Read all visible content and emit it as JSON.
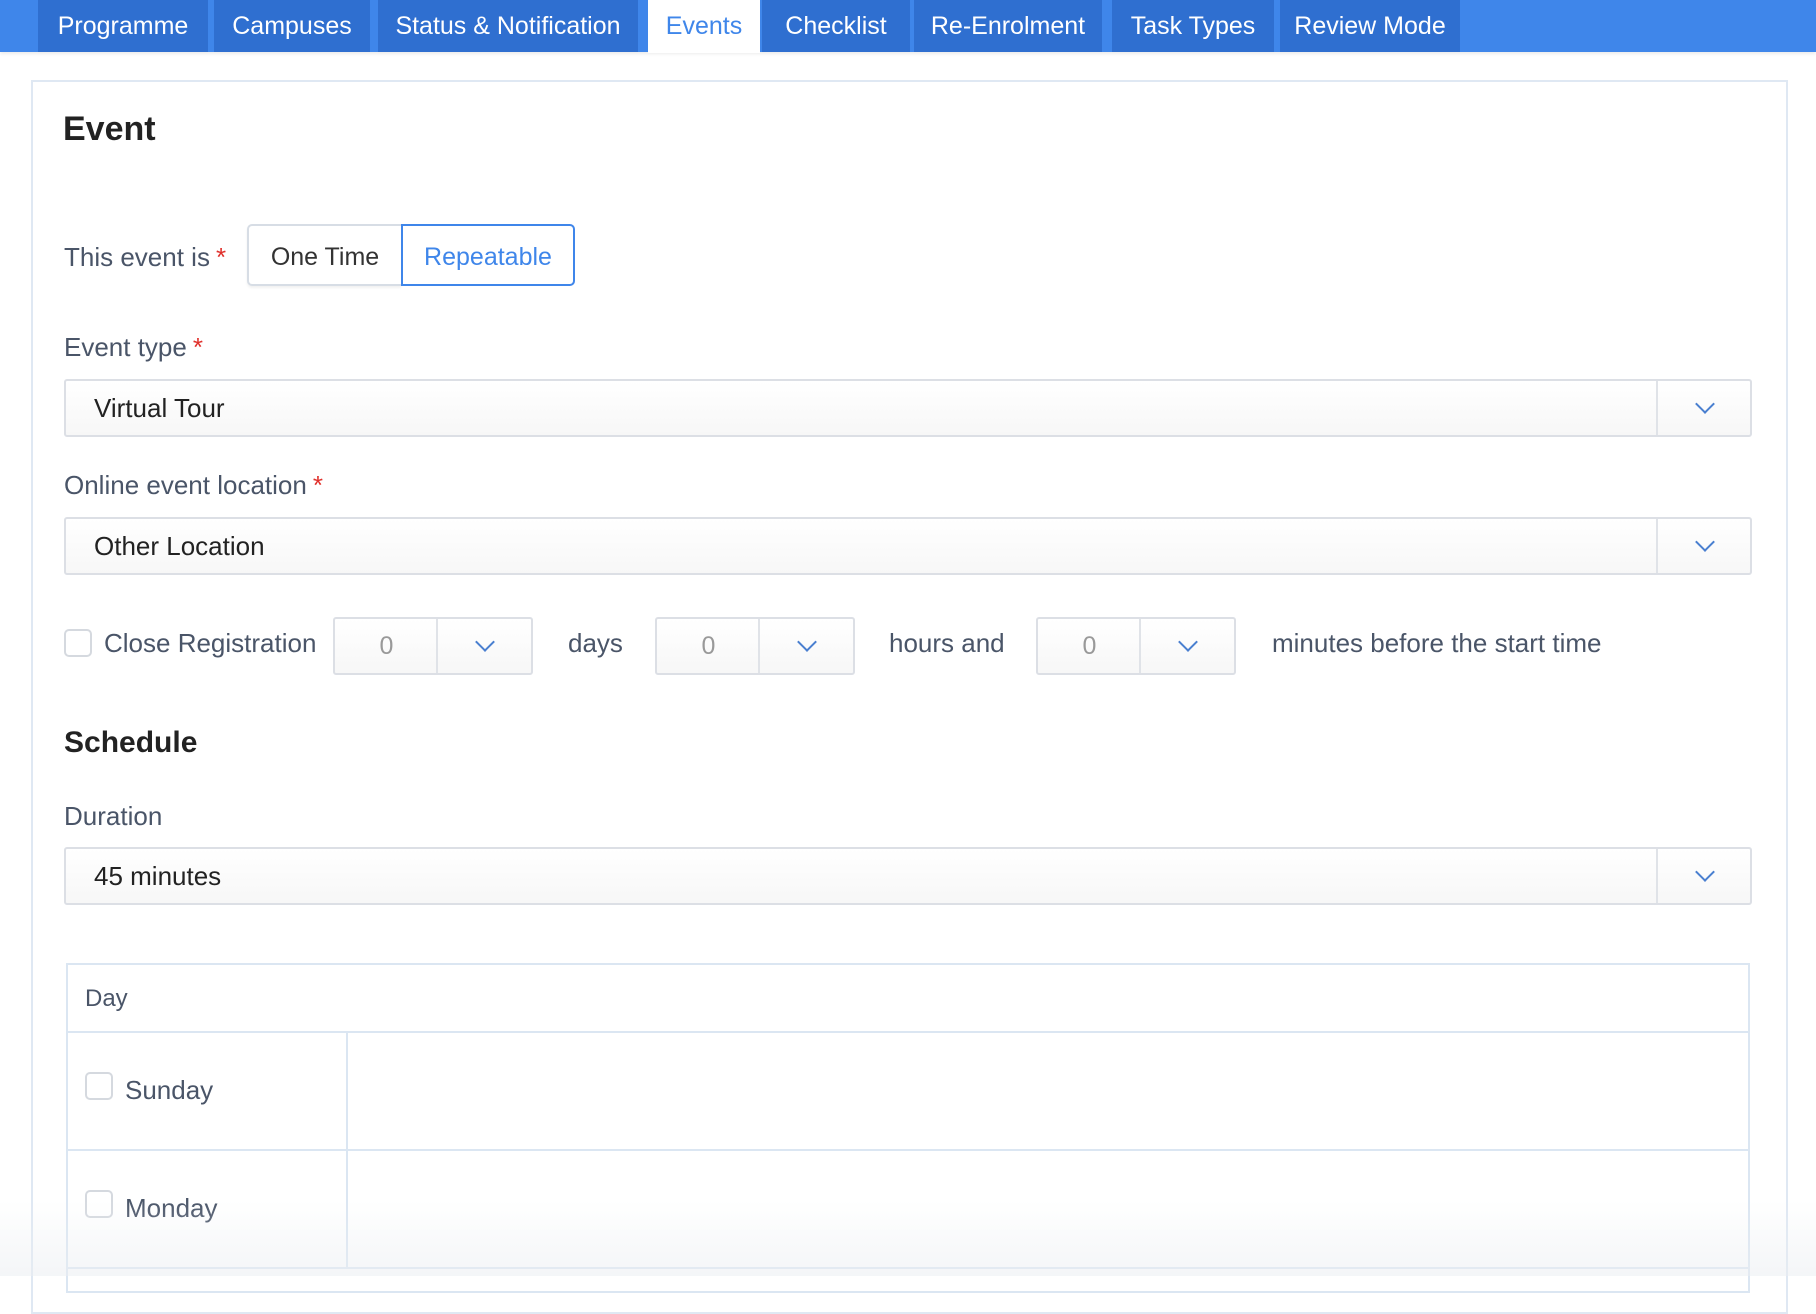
{
  "tabs": [
    {
      "label": "Programme",
      "active": false
    },
    {
      "label": "Campuses",
      "active": false
    },
    {
      "label": "Status & Notification",
      "active": false
    },
    {
      "label": "Events",
      "active": true
    },
    {
      "label": "Checklist",
      "active": false
    },
    {
      "label": "Re-Enrolment",
      "active": false
    },
    {
      "label": "Task Types",
      "active": false
    },
    {
      "label": "Review Mode",
      "active": false
    }
  ],
  "event": {
    "heading": "Event",
    "event_is_label": "This event is",
    "required_mark": "*",
    "options": {
      "one_time": "One Time",
      "repeatable": "Repeatable",
      "selected": "Repeatable"
    },
    "event_type_label": "Event type",
    "event_type_value": "Virtual Tour",
    "location_label": "Online event location",
    "location_value": "Other Location",
    "close_registration": {
      "label": "Close Registration",
      "checked": false,
      "days_value": "0",
      "days_label": "days",
      "hours_value": "0",
      "hours_label": "hours and",
      "minutes_value": "0",
      "minutes_label": "minutes before the start time"
    }
  },
  "schedule": {
    "heading": "Schedule",
    "duration_label": "Duration",
    "duration_value": "45 minutes",
    "day_column_header": "Day",
    "days": [
      {
        "name": "Sunday",
        "checked": false
      },
      {
        "name": "Monday",
        "checked": false
      }
    ]
  },
  "colors": {
    "tab_bar": "#3f86ea",
    "tab_bg": "#2f6fd0",
    "accent": "#3f86ea",
    "required": "#e0302b"
  },
  "icons": {
    "select_caret": "chevron-down-icon"
  }
}
